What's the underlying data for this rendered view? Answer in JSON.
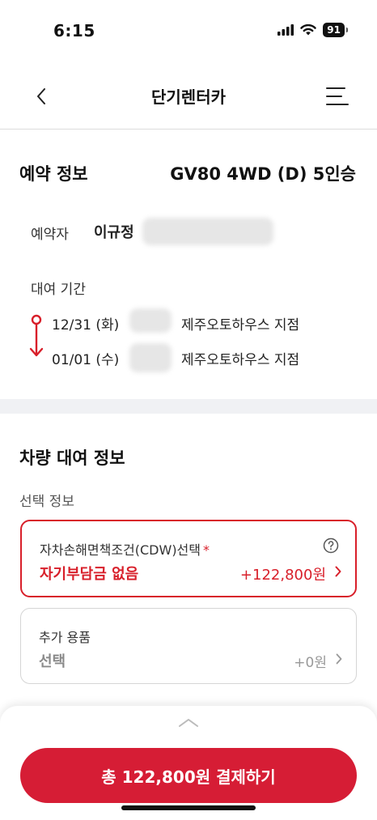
{
  "status": {
    "time": "6:15",
    "battery": "91"
  },
  "header": {
    "title": "단기렌터카"
  },
  "reservation": {
    "section_title": "예약 정보",
    "car_name": "GV80 4WD (D) 5인승",
    "reserver_label": "예약자",
    "reserver_name": "이규정",
    "period_label": "대여 기간",
    "pickup": {
      "date": "12/31 (화)",
      "branch": "제주오토하우스 지점"
    },
    "return": {
      "date": "01/01 (수)",
      "branch": "제주오토하우스 지점"
    }
  },
  "rental_info": {
    "section_title": "차량 대여 정보",
    "select_label": "선택 정보",
    "cdw": {
      "label": "자차손해면책조건(CDW)선택",
      "required_mark": "*",
      "value": "자기부담금 없음",
      "price": "+122,800원"
    },
    "extras": {
      "label": "추가 용품",
      "value": "선택",
      "price": "+0원"
    }
  },
  "bottom": {
    "pay_button": "총 122,800원 결제하기"
  },
  "colors": {
    "accent": "#d81f2a",
    "pay_button": "#d61d35"
  }
}
